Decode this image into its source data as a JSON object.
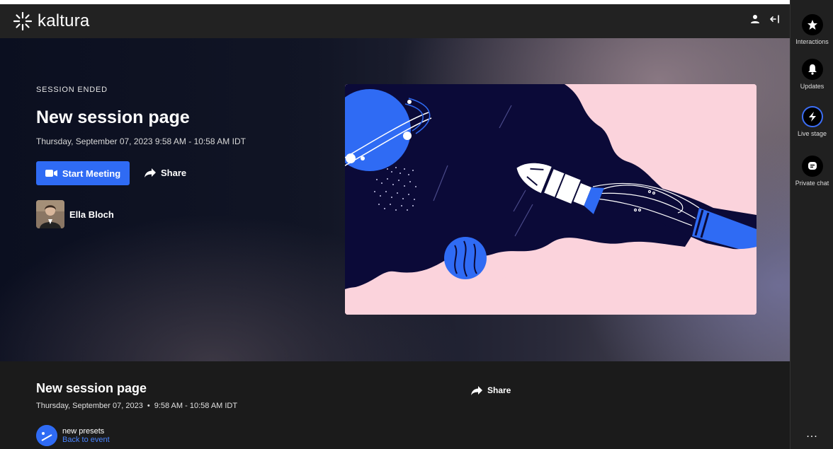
{
  "brand": {
    "name": "kaltura",
    "accent": "#2f6bf4",
    "link": "#4a85ff"
  },
  "header": {
    "icons": [
      "user-icon",
      "logout-icon"
    ]
  },
  "sidebar": {
    "items": [
      {
        "label": "Interactions",
        "icon": "star-icon"
      },
      {
        "label": "Updates",
        "icon": "bell-icon"
      },
      {
        "label": "Live stage",
        "icon": "bolt-icon"
      },
      {
        "label": "Private chat",
        "icon": "chat-icon"
      }
    ],
    "more_label": "..."
  },
  "hero": {
    "status": "SESSION ENDED",
    "title": "New session page",
    "datetime": "Thursday, September 07, 2023  9:58 AM - 10:58 AM IDT",
    "start_button": "Start Meeting",
    "share_button": "Share",
    "speaker_name": "Ella Bloch"
  },
  "bottom": {
    "title": "New session page",
    "date": "Thursday, September 07, 2023",
    "bullet": "•",
    "time": "9:58 AM - 10:58 AM IDT",
    "share_button": "Share",
    "preset_name": "new presets",
    "back_link": "Back to event"
  }
}
